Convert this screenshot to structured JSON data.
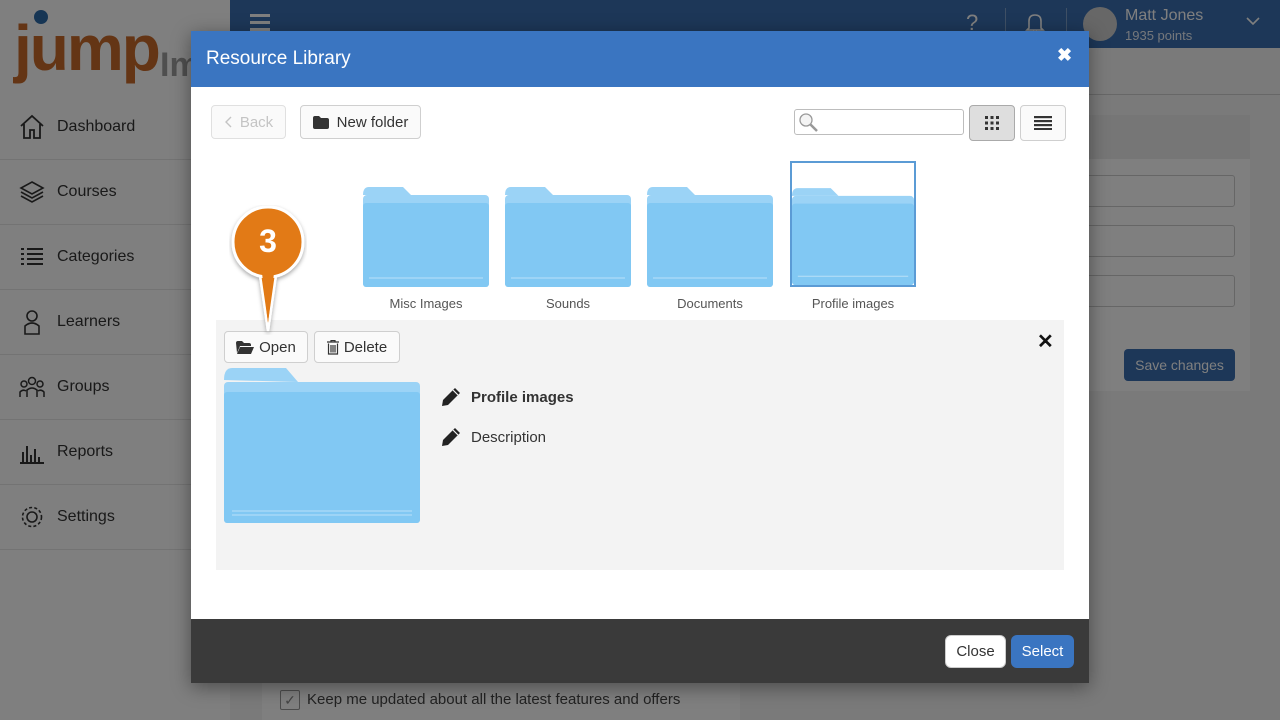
{
  "app": {
    "logo_text": "jump",
    "logo_ext": "Im",
    "nav": [
      {
        "label": "Dashboard",
        "icon": "home-icon"
      },
      {
        "label": "Courses",
        "icon": "layers-icon"
      },
      {
        "label": "Categories",
        "icon": "list-icon"
      },
      {
        "label": "Learners",
        "icon": "person-icon"
      },
      {
        "label": "Groups",
        "icon": "group-icon"
      },
      {
        "label": "Reports",
        "icon": "bar-chart-icon"
      },
      {
        "label": "Settings",
        "icon": "gear-icon"
      }
    ],
    "topbar": {
      "help_glyph": "?",
      "user_name": "Matt Jones",
      "user_points": "1935 points"
    },
    "save_label": "Save changes",
    "keep_updated_label": "Keep me updated about all the latest features and offers",
    "keep_updated_checked": true
  },
  "modal": {
    "title": "Resource Library",
    "close_glyph": "✖",
    "back_label": "Back",
    "new_folder_label": "New folder",
    "search": {
      "value": "",
      "placeholder": ""
    },
    "view_mode": "grid",
    "folders": [
      {
        "name": "Misc Images",
        "selected": false
      },
      {
        "name": "Sounds",
        "selected": false
      },
      {
        "name": "Documents",
        "selected": false
      },
      {
        "name": "Profile images",
        "selected": true
      }
    ],
    "detail": {
      "open_label": "Open",
      "delete_label": "Delete",
      "close_glyph": "✕",
      "name": "Profile images",
      "description": "Description"
    },
    "footer": {
      "close_label": "Close",
      "select_label": "Select"
    }
  },
  "callout": {
    "step": "3",
    "color": "#e27a12"
  },
  "colors": {
    "primary": "#3a75c1",
    "folder": "#81c8f3",
    "folder_tab": "#9bd3f6"
  }
}
